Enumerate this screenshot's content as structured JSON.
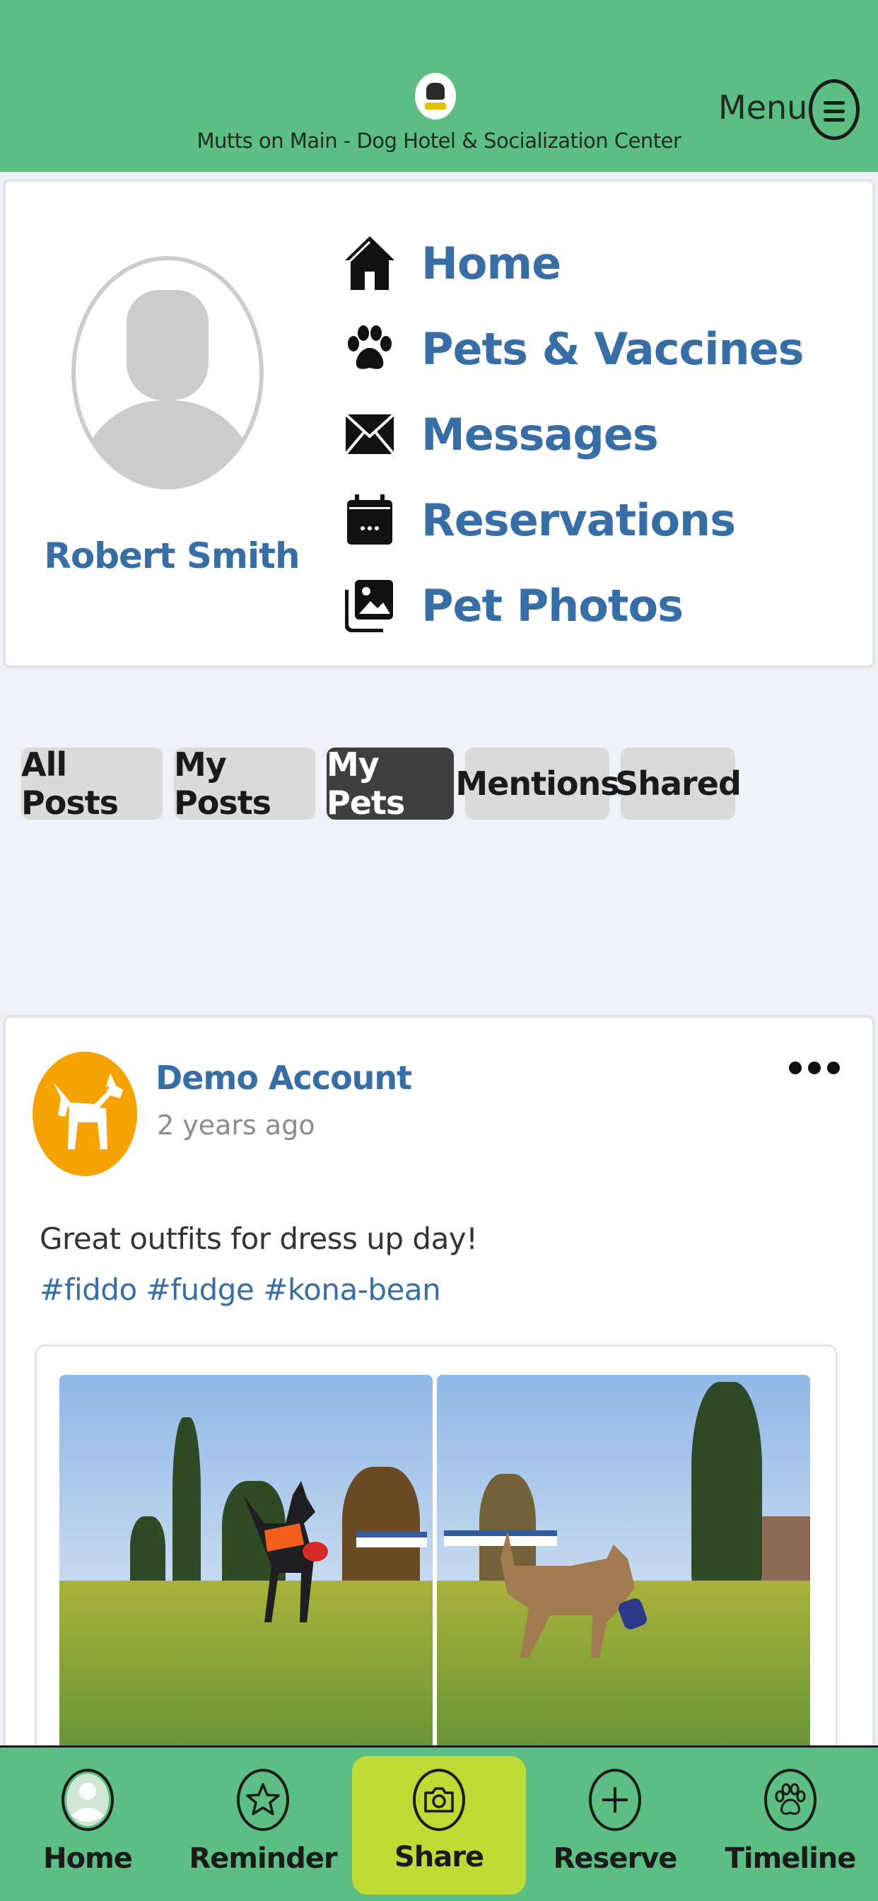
{
  "header": {
    "site_name": "Mutts on Main - Dog Hotel & Socialization Center",
    "menu_label": "Menu"
  },
  "profile": {
    "user_name": "Robert Smith",
    "nav": [
      {
        "label": "Home",
        "icon": "house-icon"
      },
      {
        "label": "Pets & Vaccines",
        "icon": "paw-icon"
      },
      {
        "label": "Messages",
        "icon": "envelope-icon"
      },
      {
        "label": "Reservations",
        "icon": "calendar-icon"
      },
      {
        "label": "Pet Photos",
        "icon": "photos-icon"
      }
    ]
  },
  "filters": [
    {
      "label": "All Posts",
      "active": false
    },
    {
      "label": "My Posts",
      "active": false
    },
    {
      "label": "My Pets",
      "active": true
    },
    {
      "label": "Mentions",
      "active": false
    },
    {
      "label": "Shared",
      "active": false
    }
  ],
  "post": {
    "author": "Demo Account",
    "time": "2 years ago",
    "text": "Great outfits for dress up day!",
    "tags": "#fiddo #fudge #kona-bean"
  },
  "tabbar": [
    {
      "label": "Home",
      "icon": "person-icon"
    },
    {
      "label": "Reminder",
      "icon": "star-icon"
    },
    {
      "label": "Share",
      "icon": "camera-icon",
      "active": true
    },
    {
      "label": "Reserve",
      "icon": "plus-icon"
    },
    {
      "label": "Timeline",
      "icon": "paw-icon"
    }
  ],
  "colors": {
    "header_bg": "#5cbe83",
    "link_blue": "#376ea6",
    "active_pill": "#3f3f3f",
    "share_tab": "#bfd935",
    "avatar_orange": "#f6a300"
  }
}
